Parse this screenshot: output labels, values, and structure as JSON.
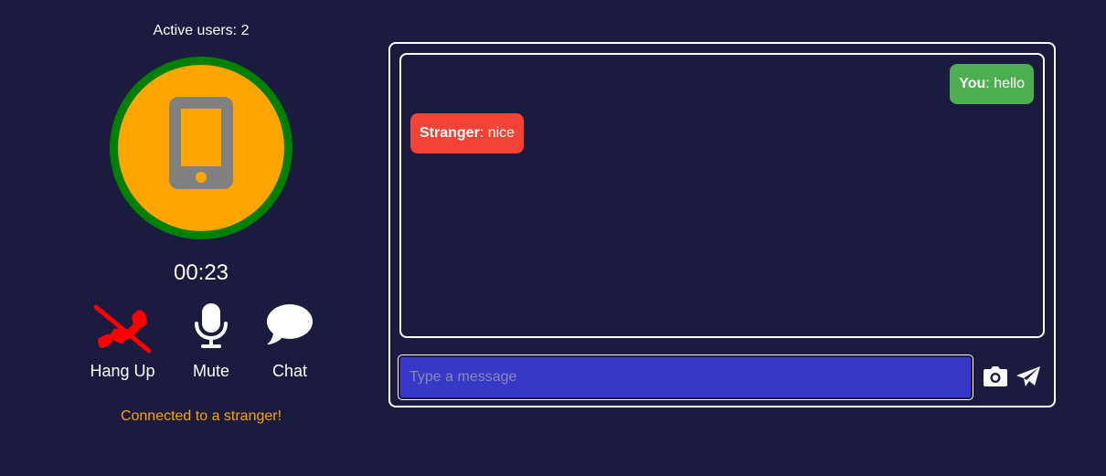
{
  "header": {
    "active_users": "Active users: 2"
  },
  "call": {
    "avatar_icon": "smartphone-icon",
    "timer": "00:23",
    "status": "Connected to a stranger!",
    "ring_color": "#008000",
    "avatar_bg": "#ffa500"
  },
  "controls": [
    {
      "label": "Hang Up",
      "icon": "phone-slash-icon",
      "color": "#ff0000"
    },
    {
      "label": "Mute",
      "icon": "microphone-icon",
      "color": "#ffffff"
    },
    {
      "label": "Chat",
      "icon": "speech-bubble-icon",
      "color": "#ffffff"
    }
  ],
  "chat": {
    "messages": [
      {
        "sender": "You",
        "text": ": hello",
        "color": "#4caf50"
      },
      {
        "sender": "Stranger",
        "text": ": nice",
        "color": "#f44336"
      }
    ],
    "input": {
      "value": "",
      "placeholder": "Type a message"
    },
    "camera_icon": "camera-icon",
    "send_icon": "paper-plane-icon"
  },
  "colors": {
    "background": "#1b1a3f",
    "input_bg": "#3737c8",
    "status_text": "#ffa500"
  }
}
